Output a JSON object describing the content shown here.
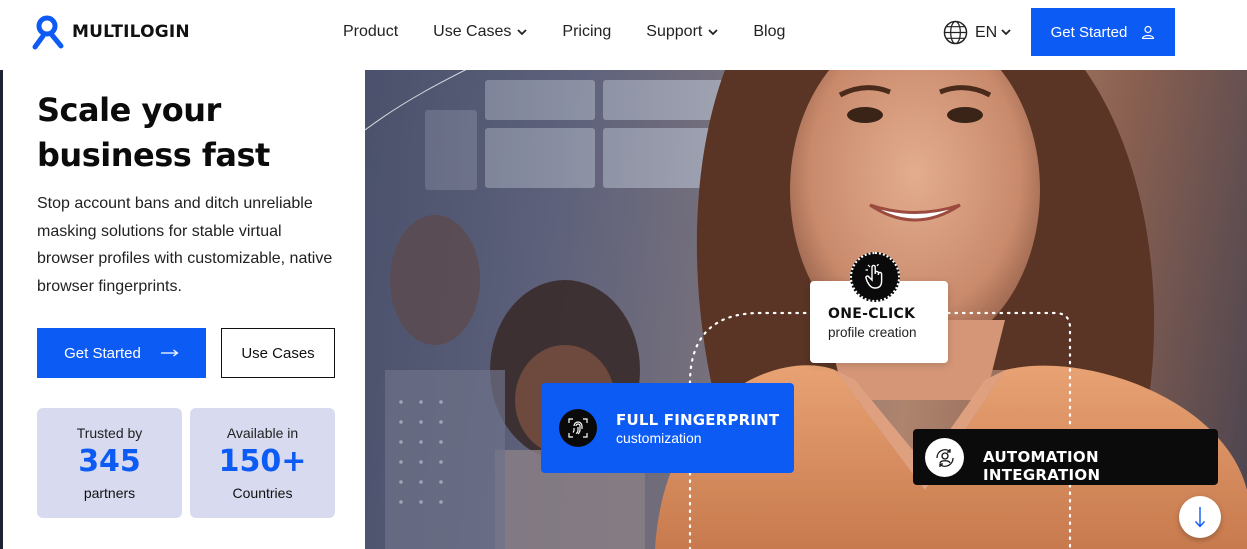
{
  "nav": {
    "brand": "MULTILOGIN",
    "menu": [
      {
        "label": "Product",
        "has_dropdown": false
      },
      {
        "label": "Use Cases",
        "has_dropdown": true
      },
      {
        "label": "Pricing",
        "has_dropdown": false
      },
      {
        "label": "Support",
        "has_dropdown": true
      },
      {
        "label": "Blog",
        "has_dropdown": false
      }
    ],
    "language": "EN",
    "cta_label": "Get Started"
  },
  "hero": {
    "headline_line1": "Scale your",
    "headline_line2": "business fast",
    "subtitle": "Stop account bans and ditch unreliable masking solutions for stable virtual browser profiles with customizable, native browser fingerprints.",
    "primary_button": "Get Started",
    "secondary_button": "Use Cases",
    "stats": [
      {
        "top": "Trusted by",
        "value": "345",
        "bottom": "partners"
      },
      {
        "top": "Available in",
        "value": "150+",
        "bottom": "Countries"
      }
    ]
  },
  "badges": {
    "one_click_title": "ONE-CLICK",
    "one_click_sub": "profile creation",
    "fingerprint_title": "FULL FINGERPRINT",
    "fingerprint_sub": "customization",
    "automation_title": "AUTOMATION INTEGRATION"
  },
  "colors": {
    "accent": "#0d5bf5",
    "stat_bg": "#d8daf0",
    "dark": "#0b0b0b"
  },
  "icons": [
    "logo-mark-icon",
    "chevron-down-icon",
    "globe-icon",
    "user-icon",
    "arrow-right-icon",
    "pointer-click-icon",
    "fingerprint-icon",
    "automation-icon",
    "arrow-down-icon"
  ]
}
